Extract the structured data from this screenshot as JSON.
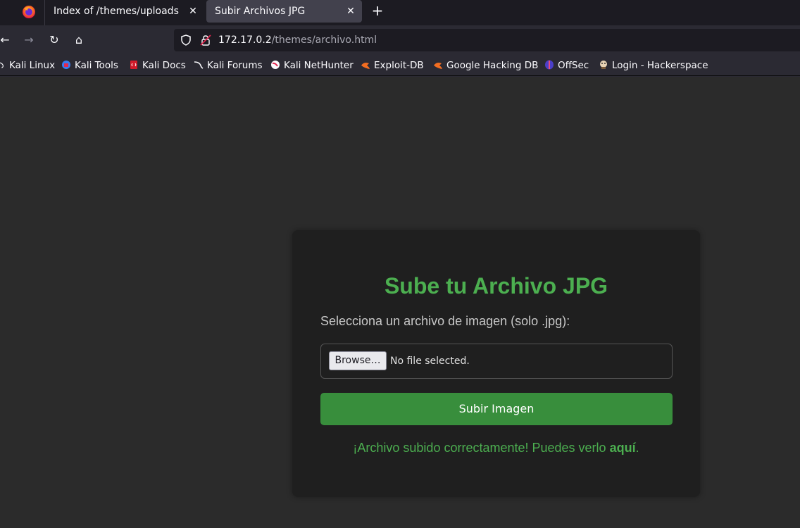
{
  "browser": {
    "tabs": [
      {
        "title": "Index of /themes/uploads",
        "active": false
      },
      {
        "title": "Subir Archivos JPG",
        "active": true
      }
    ],
    "close_glyph": "✕",
    "new_tab_glyph": "+",
    "url": {
      "host": "172.17.0.2",
      "path": "/themes/archivo.html"
    },
    "nav": {
      "back_glyph": "←",
      "forward_glyph": "→",
      "reload_glyph": "↻",
      "home_glyph": "⌂"
    },
    "bookmarks": [
      {
        "label": "Kali Linux",
        "icon": "kali-dragon-icon"
      },
      {
        "label": "Kali Tools",
        "icon": "kali-tools-icon"
      },
      {
        "label": "Kali Docs",
        "icon": "kali-docs-icon"
      },
      {
        "label": "Kali Forums",
        "icon": "kali-forums-icon"
      },
      {
        "label": "Kali NetHunter",
        "icon": "nethunter-icon"
      },
      {
        "label": "Exploit-DB",
        "icon": "exploit-db-icon"
      },
      {
        "label": "Google Hacking DB",
        "icon": "ghdb-icon"
      },
      {
        "label": "OffSec",
        "icon": "offsec-icon"
      },
      {
        "label": "Login - Hackerspace",
        "icon": "hackerspace-icon"
      }
    ]
  },
  "page": {
    "title": "Sube tu Archivo JPG",
    "label": "Selecciona un archivo de imagen (solo .jpg):",
    "file_input": {
      "button_label": "Browse…",
      "status": "No file selected."
    },
    "submit_label": "Subir Imagen",
    "success": {
      "text": "¡Archivo subido correctamente! Puedes verlo ",
      "link_text": "aquí",
      "suffix": "."
    },
    "colors": {
      "accent_green": "#4caf50",
      "button_green": "#388e3c",
      "card_bg": "#1f1f1f",
      "page_bg": "#2b2b2b"
    }
  }
}
